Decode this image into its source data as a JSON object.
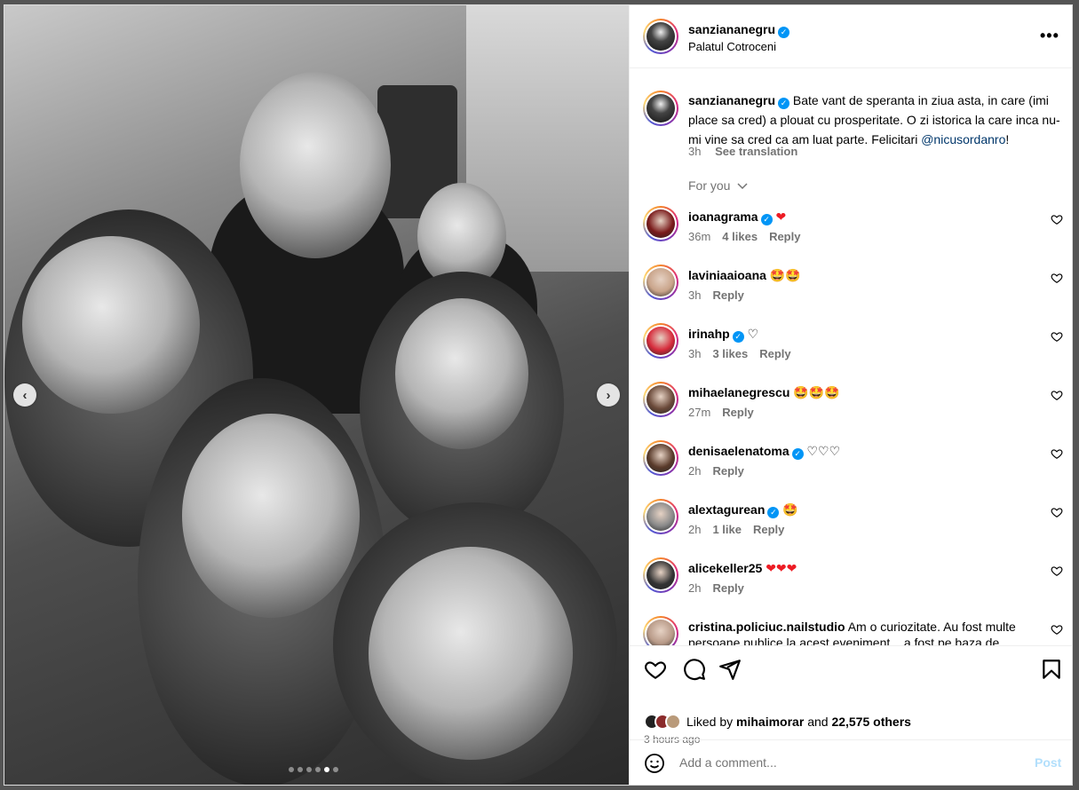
{
  "post": {
    "username": "sanziananegru",
    "location": "Palatul Cotroceni",
    "caption_text": "Bate vant de speranta in ziua asta, in care (imi place sa cred) a plouat cu prosperitate. O zi istorica la care inca nu-mi vine sa cred ca am luat parte. Felicitari ",
    "caption_mention": "@nicusordanro",
    "caption_end": "!",
    "caption_time": "3h",
    "see_translation": "See translation",
    "for_you": "For you",
    "verified_glyph": "✓",
    "more_glyph": "•••",
    "carousel_dots": 6,
    "carousel_active_index": 4
  },
  "nav": {
    "prev_glyph": "‹",
    "next_glyph": "›"
  },
  "comments": [
    {
      "user": "ioanagrama",
      "verified": true,
      "text": "❤",
      "time": "36m",
      "likes": "4 likes",
      "reply": "Reply",
      "avatar_color": "#7a1b1b"
    },
    {
      "user": "laviniaaioana",
      "verified": false,
      "text": "🤩🤩",
      "time": "3h",
      "likes": "",
      "reply": "Reply",
      "avatar_color": "#c9a48a"
    },
    {
      "user": "irinahp",
      "verified": true,
      "text": "♡",
      "time": "3h",
      "likes": "3 likes",
      "reply": "Reply",
      "avatar_color": "#d62b3b"
    },
    {
      "user": "mihaelanegrescu",
      "verified": false,
      "text": "🤩🤩🤩",
      "time": "27m",
      "likes": "",
      "reply": "Reply",
      "avatar_color": "#6b4a3a"
    },
    {
      "user": "denisaelenatoma",
      "verified": true,
      "text": "♡♡♡",
      "time": "2h",
      "likes": "",
      "reply": "Reply",
      "avatar_color": "#5a3b2b"
    },
    {
      "user": "alextagurean",
      "verified": true,
      "text": "🤩",
      "time": "2h",
      "likes": "1 like",
      "reply": "Reply",
      "avatar_color": "#8a8a8a"
    },
    {
      "user": "alicekeller25",
      "verified": false,
      "text": "❤❤❤",
      "time": "2h",
      "likes": "",
      "reply": "Reply",
      "avatar_color": "#333333"
    },
    {
      "user": "cristina.policiuc.nailstudio",
      "verified": false,
      "text": "Am o curiozitate. Au fost multe persoane publice la acest eveniment... a fost pe baza de",
      "time": "",
      "likes": "",
      "reply": "",
      "avatar_color": "#b89a88"
    }
  ],
  "actions": {
    "liked_by_prefix": "Liked by",
    "liked_by_user": "mihaimorar",
    "liked_by_and": "and",
    "liked_by_others": "22,575 others",
    "time_ago": "3 hours ago"
  },
  "add_comment": {
    "placeholder": "Add a comment...",
    "post_label": "Post"
  }
}
